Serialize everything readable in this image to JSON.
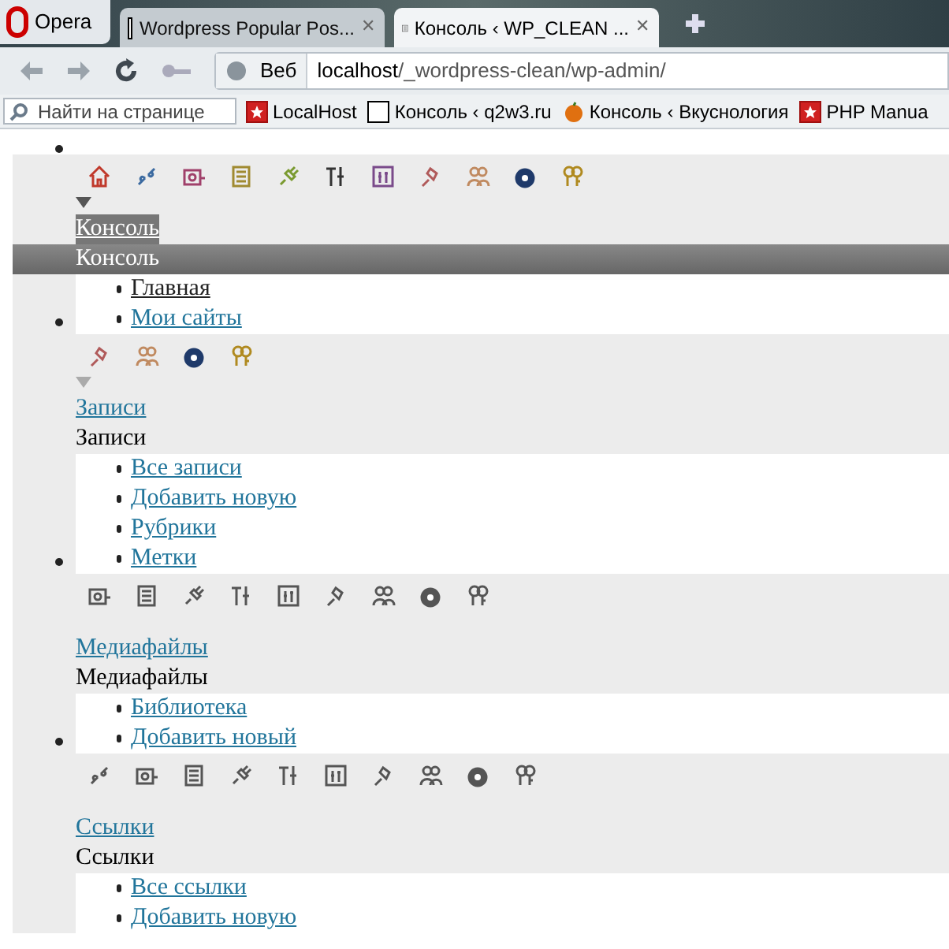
{
  "browser": {
    "menu_button": "Opera",
    "tabs": [
      {
        "title": "Wordpress Popular Pos...",
        "kind": "q2",
        "selected": false,
        "close": "✕"
      },
      {
        "title": "Консоль ‹ WP_CLEAN ...",
        "kind": "page",
        "selected": true,
        "close": "✕"
      }
    ],
    "address": {
      "scope": "Веб",
      "host": "localhost",
      "path": "/_wordpress-clean/wp-admin/"
    },
    "find": {
      "placeholder": "Найти на странице"
    },
    "bookmarks": [
      {
        "label": "LocalHost",
        "kind": "star"
      },
      {
        "label": "Консоль ‹ q2w3.ru",
        "kind": "q2"
      },
      {
        "label": "Консоль ‹ Вкуснология",
        "kind": "fruit"
      },
      {
        "label": "PHP Manua",
        "kind": "star"
      }
    ]
  },
  "menu": [
    {
      "link": "Консоль",
      "header": "Консоль",
      "current": true,
      "expanded": true,
      "icons_colored": true,
      "icons": [
        {
          "kind": "home"
        },
        {
          "kind": "link"
        },
        {
          "kind": "media"
        },
        {
          "kind": "pages"
        },
        {
          "kind": "plugin"
        },
        {
          "kind": "tools"
        },
        {
          "kind": "settings"
        },
        {
          "kind": "pin"
        },
        {
          "kind": "users"
        },
        {
          "kind": "gear"
        },
        {
          "kind": "keys"
        }
      ],
      "items": [
        {
          "label": "Главная",
          "current": true
        },
        {
          "label": "Мои сайты",
          "current": false
        }
      ]
    },
    {
      "link": "Записи",
      "header": "Записи",
      "current": false,
      "expanded": true,
      "icons_colored": true,
      "icons": [
        {
          "kind": "pin"
        },
        {
          "kind": "users"
        },
        {
          "kind": "gear"
        },
        {
          "kind": "keys"
        }
      ],
      "items": [
        {
          "label": "Все записи",
          "current": false
        },
        {
          "label": "Добавить новую",
          "current": false
        },
        {
          "label": "Рубрики",
          "current": false
        },
        {
          "label": "Метки",
          "current": false
        }
      ]
    },
    {
      "link": "Медиафайлы",
      "header": "Медиафайлы",
      "current": false,
      "expanded": false,
      "icons_colored": false,
      "icons": [
        {
          "kind": "media"
        },
        {
          "kind": "pages"
        },
        {
          "kind": "plugin"
        },
        {
          "kind": "tools"
        },
        {
          "kind": "settings"
        },
        {
          "kind": "pin"
        },
        {
          "kind": "users"
        },
        {
          "kind": "gear"
        },
        {
          "kind": "keys"
        }
      ],
      "items": [
        {
          "label": "Библиотека",
          "current": false
        },
        {
          "label": "Добавить новый",
          "current": false
        }
      ]
    },
    {
      "link": "Ссылки",
      "header": "Ссылки",
      "current": false,
      "expanded": false,
      "icons_colored": false,
      "icons": [
        {
          "kind": "link"
        },
        {
          "kind": "media"
        },
        {
          "kind": "pages"
        },
        {
          "kind": "plugin"
        },
        {
          "kind": "tools"
        },
        {
          "kind": "settings"
        },
        {
          "kind": "pin"
        },
        {
          "kind": "users"
        },
        {
          "kind": "gear"
        },
        {
          "kind": "keys"
        }
      ],
      "items": [
        {
          "label": "Все ссылки",
          "current": false
        },
        {
          "label": "Добавить новую",
          "current": false
        }
      ]
    }
  ]
}
